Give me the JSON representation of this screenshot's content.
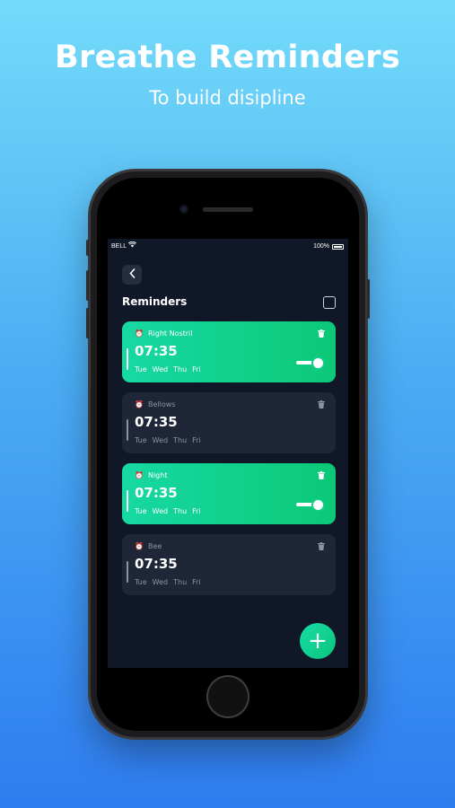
{
  "promo": {
    "headline": "Breathe Reminders",
    "subline": "To build disipline"
  },
  "status_bar": {
    "carrier": "BELL",
    "wifi_icon": "wifi-icon",
    "battery": "100%"
  },
  "header": {
    "back_icon": "chevron-left-icon",
    "title": "Reminders",
    "checkbox_icon": "checkbox-icon"
  },
  "reminders": [
    {
      "name": "Right Nostril",
      "time": "07:35",
      "days": [
        "Tue",
        "Wed",
        "Thu",
        "Fri"
      ],
      "enabled": true
    },
    {
      "name": "Bellows",
      "time": "07:35",
      "days": [
        "Tue",
        "Wed",
        "Thu",
        "Fri"
      ],
      "enabled": false
    },
    {
      "name": "Night",
      "time": "07:35",
      "days": [
        "Tue",
        "Wed",
        "Thu",
        "Fri"
      ],
      "enabled": true
    },
    {
      "name": "Bee",
      "time": "07:35",
      "days": [
        "Tue",
        "Wed",
        "Thu",
        "Fri"
      ],
      "enabled": false
    }
  ],
  "fab": {
    "icon": "plus-icon",
    "glyph": "+"
  },
  "colors": {
    "accent": "#12CF8C",
    "screen_bg": "#101726",
    "card_off": "#1E2638",
    "bg_top": "#73DBFA",
    "bg_bottom": "#2F7CF0"
  }
}
